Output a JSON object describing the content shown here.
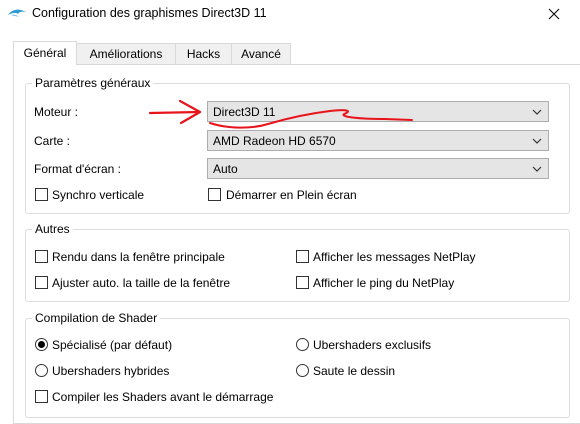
{
  "window": {
    "title": "Configuration des graphismes Direct3D 11"
  },
  "tabs": [
    {
      "label": "Général",
      "active": true
    },
    {
      "label": "Améliorations",
      "active": false
    },
    {
      "label": "Hacks",
      "active": false
    },
    {
      "label": "Avancé",
      "active": false
    }
  ],
  "general": {
    "title": "Paramètres généraux",
    "backend": {
      "label": "Moteur :",
      "value": "Direct3D 11"
    },
    "adapter": {
      "label": "Carte :",
      "value": "AMD Radeon HD 6570"
    },
    "aspect": {
      "label": "Format d'écran :",
      "value": "Auto"
    },
    "vsync": {
      "label": "Synchro verticale",
      "checked": false
    },
    "fullscreen": {
      "label": "Démarrer en Plein écran",
      "checked": false
    }
  },
  "other": {
    "title": "Autres",
    "render_main": {
      "label": "Rendu dans la fenêtre principale",
      "checked": false
    },
    "netplay_msgs": {
      "label": "Afficher les messages NetPlay",
      "checked": false
    },
    "auto_size": {
      "label": "Ajuster auto. la taille de la fenêtre",
      "checked": false
    },
    "netplay_ping": {
      "label": "Afficher le ping du NetPlay",
      "checked": false
    }
  },
  "shader": {
    "title": "Compilation de Shader",
    "specialized": {
      "label": "Spécialisé (par défaut)",
      "selected": true
    },
    "exclusive": {
      "label": "Ubershaders exclusifs",
      "selected": false
    },
    "hybrid": {
      "label": "Ubershaders hybrides",
      "selected": false
    },
    "skip": {
      "label": "Saute le dessin",
      "selected": false
    },
    "precompile": {
      "label": "Compiler les Shaders avant le démarrage",
      "checked": false
    }
  },
  "colors": {
    "annotation": "#e8141b",
    "icon": "#2d9bd6"
  },
  "icons": {
    "app": "dolphin-icon",
    "close": "close-icon",
    "dropdown": "chevron-down-icon"
  }
}
